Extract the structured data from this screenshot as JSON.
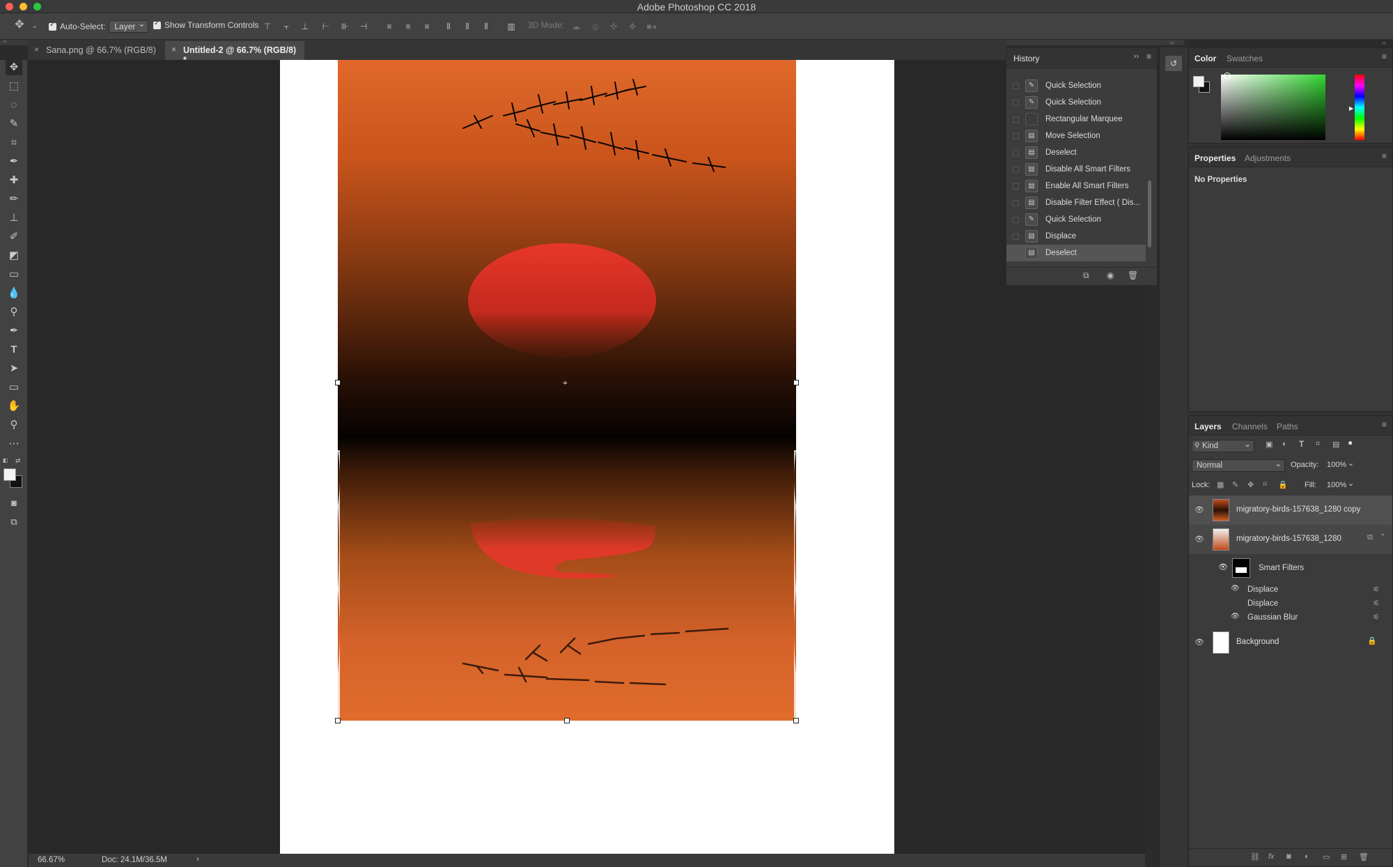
{
  "window": {
    "title": "Adobe Photoshop CC 2018"
  },
  "options_bar": {
    "auto_select_label": "Auto-Select:",
    "auto_select_value": "Layer",
    "show_transform_label": "Show Transform Controls",
    "mode_3d_label": "3D Mode:"
  },
  "tabs": [
    {
      "label": "Sana.png @ 66.7% (RGB/8)",
      "active": false
    },
    {
      "label": "Untitled-2 @ 66.7% (RGB/8) *",
      "active": true
    }
  ],
  "history": {
    "title": "History",
    "items": [
      {
        "label": "Quick Selection",
        "icon": "quick-selection-icon"
      },
      {
        "label": "Quick Selection",
        "icon": "quick-selection-icon"
      },
      {
        "label": "Rectangular Marquee",
        "icon": "marquee-icon"
      },
      {
        "label": "Move Selection",
        "icon": "document-icon"
      },
      {
        "label": "Deselect",
        "icon": "document-icon"
      },
      {
        "label": "Disable All Smart Filters",
        "icon": "document-icon"
      },
      {
        "label": "Enable All Smart Filters",
        "icon": "document-icon"
      },
      {
        "label": "Disable Filter Effect ( Dis...",
        "icon": "document-icon"
      },
      {
        "label": "Quick Selection",
        "icon": "quick-selection-icon"
      },
      {
        "label": "Displace",
        "icon": "document-icon"
      },
      {
        "label": "Deselect",
        "icon": "document-icon",
        "selected": true
      }
    ]
  },
  "color_panel": {
    "tab_color": "Color",
    "tab_swatches": "Swatches"
  },
  "properties_panel": {
    "tab_properties": "Properties",
    "tab_adjustments": "Adjustments",
    "content": "No Properties"
  },
  "layers_panel": {
    "tab_layers": "Layers",
    "tab_channels": "Channels",
    "tab_paths": "Paths",
    "filter_kind": "Kind",
    "blend_mode": "Normal",
    "opacity_label": "Opacity:",
    "opacity_value": "100%",
    "lock_label": "Lock:",
    "fill_label": "Fill:",
    "fill_value": "100%",
    "layers": [
      {
        "name": "migratory-birds-157638_1280 copy"
      },
      {
        "name": "migratory-birds-157638_1280"
      }
    ],
    "smart_filters_label": "Smart Filters",
    "filters": [
      "Displace",
      "Displace",
      "Gaussian Blur"
    ],
    "background_layer": "Background"
  },
  "status": {
    "zoom": "66.67%",
    "doc": "Doc: 24.1M/36.5M"
  },
  "colors": {
    "accent_orange": "#e0692a",
    "sun_red": "#e23526"
  }
}
